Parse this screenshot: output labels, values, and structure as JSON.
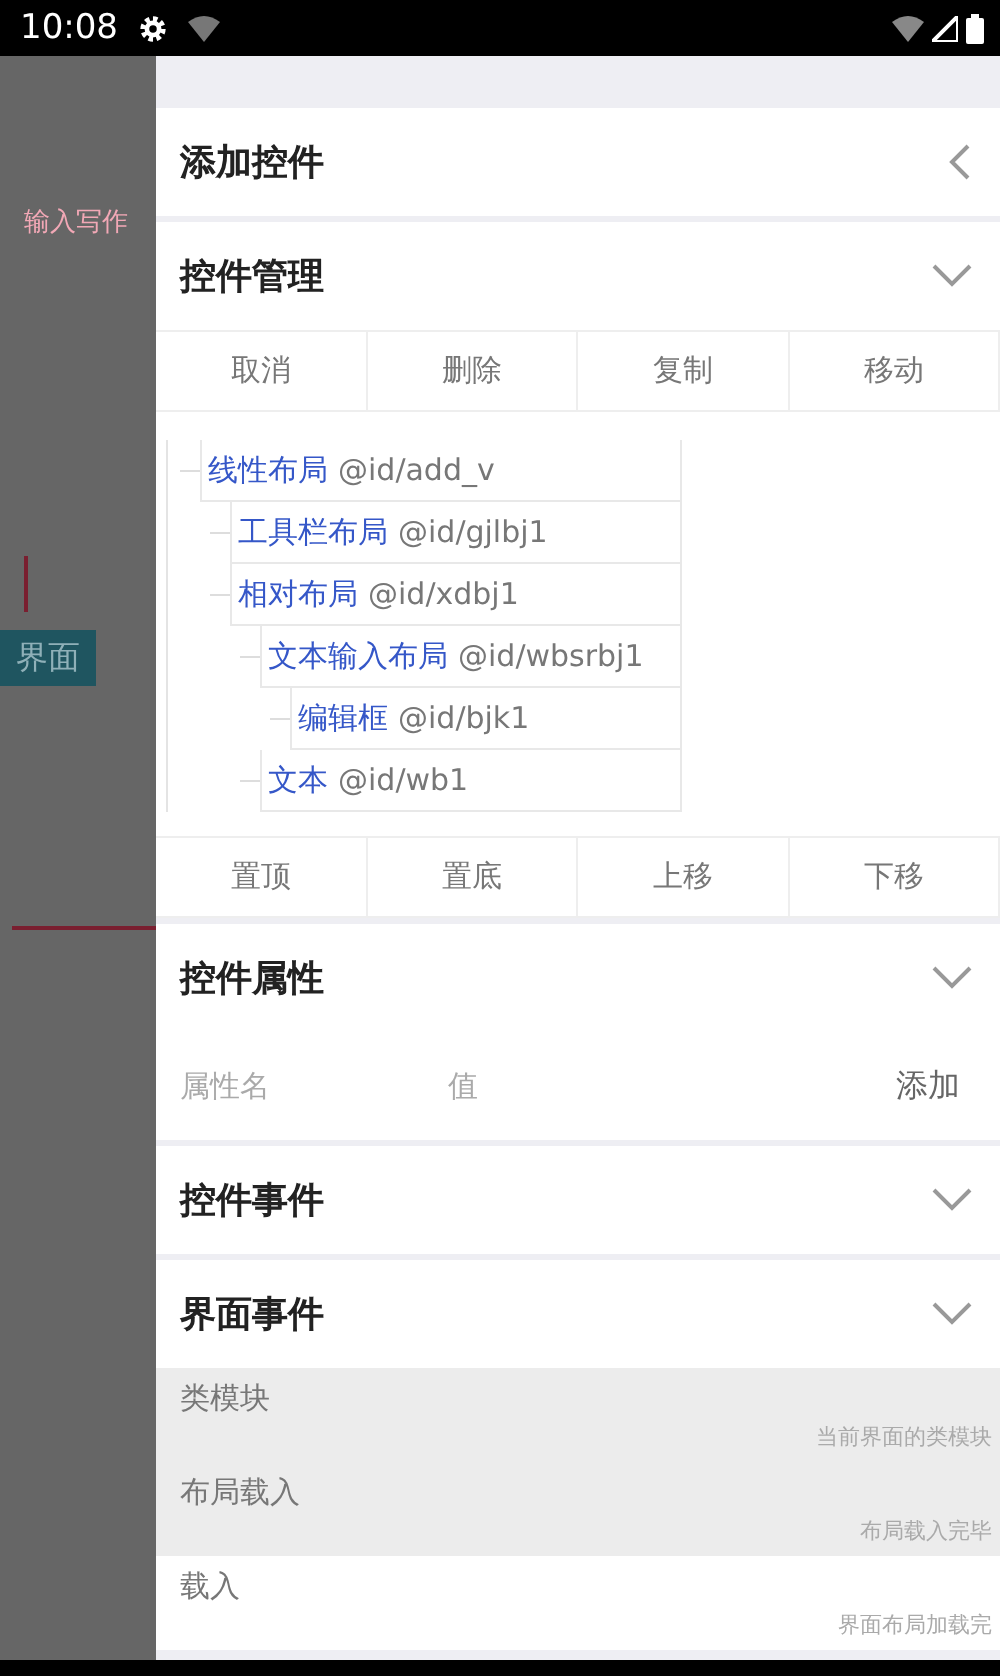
{
  "status_bar": {
    "time": "10:08"
  },
  "background": {
    "hint": "输入写作",
    "tab": "界面"
  },
  "drawer": {
    "sections": [
      {
        "kind": "back",
        "title": "添加控件"
      },
      {
        "kind": "collapse",
        "title": "控件管理",
        "toolbar": [
          "取消",
          "删除",
          "复制",
          "移动"
        ],
        "tree": [
          {
            "name": "线性布局",
            "id": "@id/add_v",
            "children": [
              {
                "name": "工具栏布局",
                "id": "@id/gjlbj1"
              },
              {
                "name": "相对布局",
                "id": "@id/xdbj1",
                "children": [
                  {
                    "name": "文本输入布局",
                    "id": "@id/wbsrbj1",
                    "children": [
                      {
                        "name": "编辑框",
                        "id": "@id/bjk1"
                      }
                    ]
                  },
                  {
                    "name": "文本",
                    "id": "@id/wb1"
                  }
                ]
              }
            ]
          }
        ],
        "order_buttons": [
          "置顶",
          "置底",
          "上移",
          "下移"
        ]
      },
      {
        "kind": "collapse",
        "title": "控件属性",
        "attribute_row": {
          "name_field": {
            "placeholder": "属性名"
          },
          "value_field": {
            "placeholder": "值"
          },
          "add_button": "添加"
        }
      },
      {
        "kind": "collapse",
        "title": "控件事件"
      },
      {
        "kind": "collapse",
        "title": "界面事件",
        "events": [
          {
            "title": "类模块",
            "description": "当前界面的类模块",
            "selected": true
          },
          {
            "title": "布局载入",
            "description": "布局载入完毕",
            "selected": true
          },
          {
            "title": "载入",
            "description": "界面布局加载完",
            "selected": false
          }
        ]
      }
    ]
  }
}
